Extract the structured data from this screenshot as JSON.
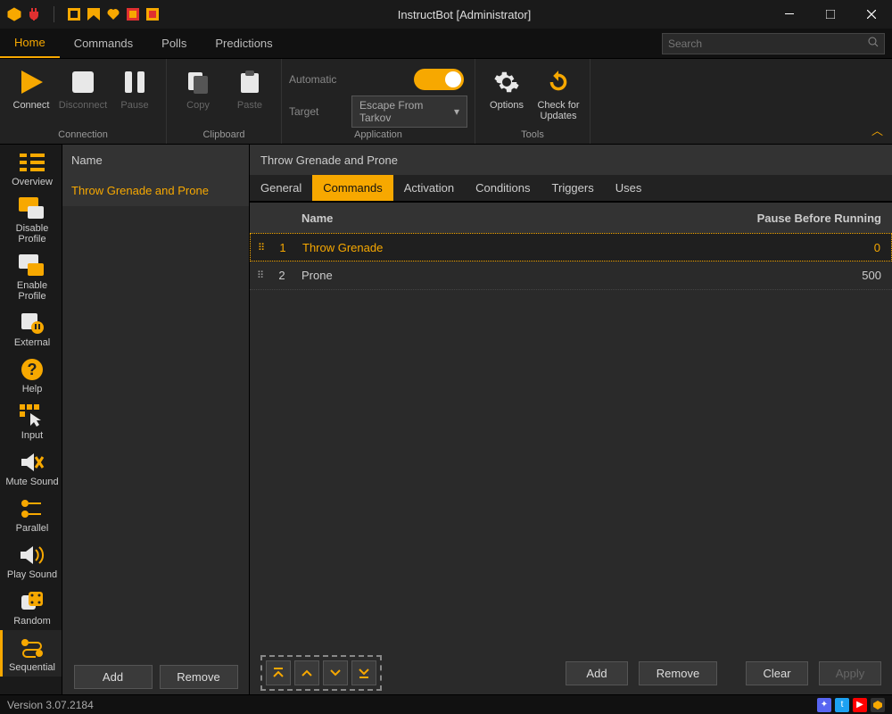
{
  "window": {
    "title": "InstructBot [Administrator]"
  },
  "menubar": {
    "items": [
      "Home",
      "Commands",
      "Polls",
      "Predictions"
    ],
    "active": 0,
    "search_placeholder": "Search"
  },
  "ribbon": {
    "groups": {
      "connection": {
        "label": "Connection",
        "connect": "Connect",
        "disconnect": "Disconnect",
        "pause": "Pause"
      },
      "clipboard": {
        "label": "Clipboard",
        "copy": "Copy",
        "paste": "Paste"
      },
      "application": {
        "label": "Application",
        "automatic_label": "Automatic",
        "target_label": "Target",
        "target_value": "Escape From Tarkov"
      },
      "tools": {
        "label": "Tools",
        "options": "Options",
        "updates": "Check for Updates"
      }
    }
  },
  "sidebar": {
    "items": [
      {
        "label": "Overview"
      },
      {
        "label": "Disable Profile"
      },
      {
        "label": "Enable Profile"
      },
      {
        "label": "External"
      },
      {
        "label": "Help"
      },
      {
        "label": "Input"
      },
      {
        "label": "Mute Sound"
      },
      {
        "label": "Parallel"
      },
      {
        "label": "Play Sound"
      },
      {
        "label": "Random"
      },
      {
        "label": "Sequential"
      }
    ],
    "active": 10
  },
  "list": {
    "header": "Name",
    "items": [
      "Throw Grenade and Prone"
    ],
    "add_label": "Add",
    "remove_label": "Remove"
  },
  "detail": {
    "title": "Throw Grenade and Prone",
    "tabs": [
      "General",
      "Commands",
      "Activation",
      "Conditions",
      "Triggers",
      "Uses"
    ],
    "active_tab": 1,
    "columns": {
      "name": "Name",
      "pause": "Pause Before Running"
    },
    "rows": [
      {
        "idx": "1",
        "name": "Throw Grenade",
        "pause": "0"
      },
      {
        "idx": "2",
        "name": "Prone",
        "pause": "500"
      }
    ],
    "toolbar": {
      "add": "Add",
      "remove": "Remove",
      "clear": "Clear",
      "apply": "Apply"
    }
  },
  "status": {
    "version": "Version 3.07.2184"
  }
}
